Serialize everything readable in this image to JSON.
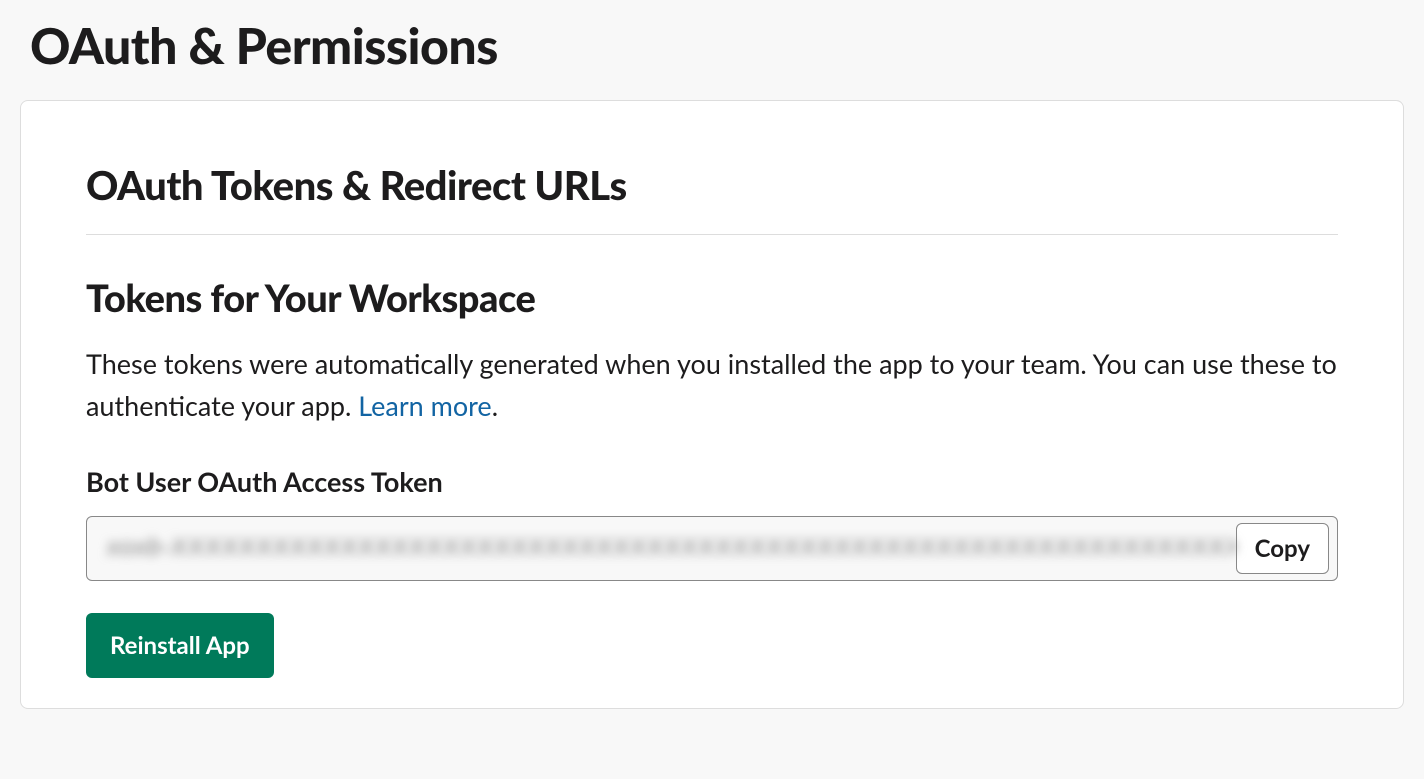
{
  "pageTitle": "OAuth & Permissions",
  "card": {
    "sectionTitle": "OAuth Tokens & Redirect URLs",
    "subTitle": "Tokens for Your Workspace",
    "descPart1": "These tokens were automatically generated when you installed the app to your team. You can use these to authenticate your app. ",
    "learnMore": "Learn more",
    "descPart2": ".",
    "tokenLabel": "Bot User OAuth Access Token",
    "tokenValue": "xoxb-XXXXXXXXXXXXXXXXXXXXXXXXXXXXXXXXXXXXXXXXXXXXXXXXXXXXXXXXXXXXXXXXXXXXXXXXXXXXXXXXXXXXX",
    "copyLabel": "Copy",
    "reinstallLabel": "Reinstall App"
  }
}
